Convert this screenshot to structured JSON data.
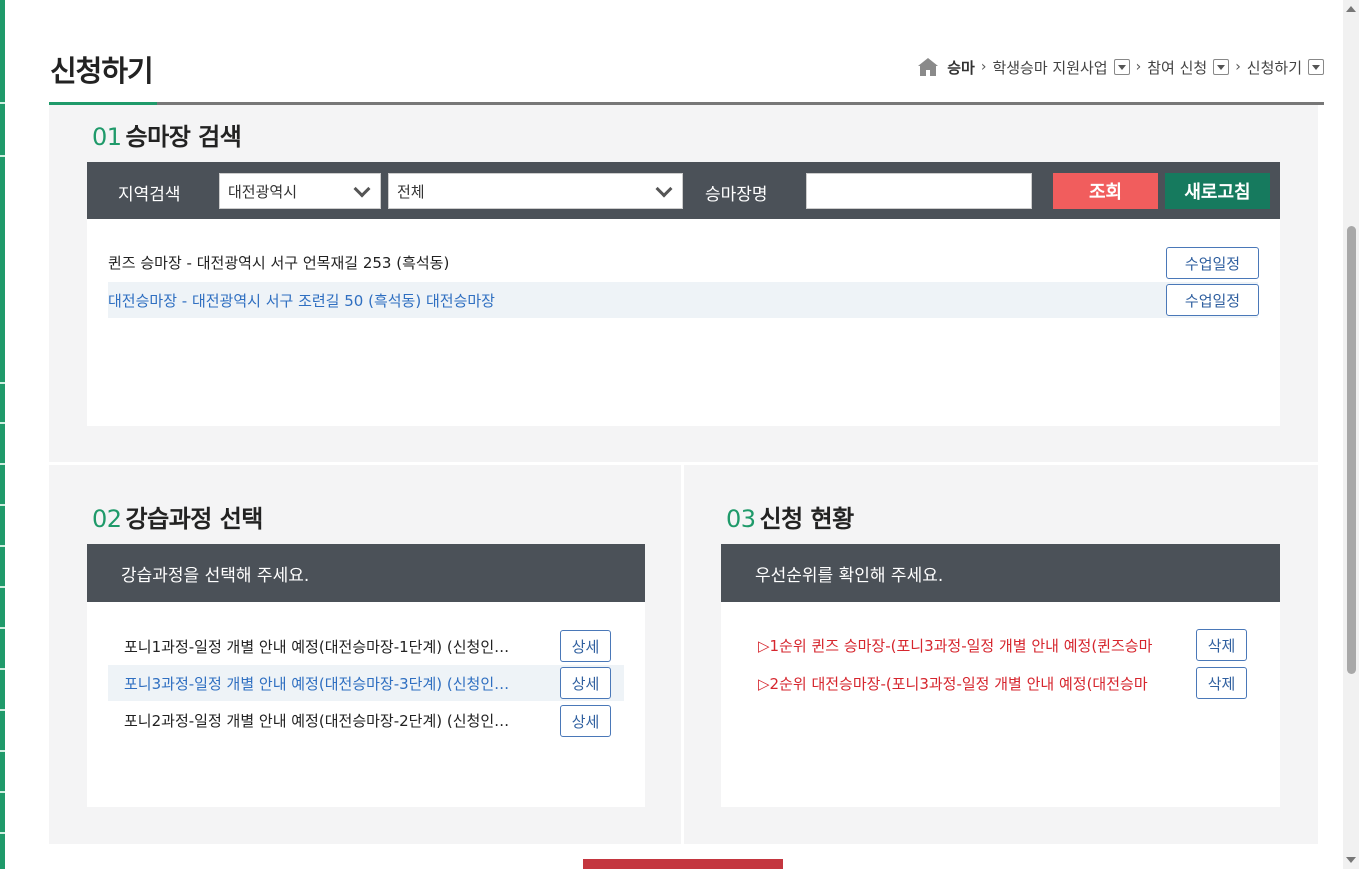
{
  "page_title": "신청하기",
  "breadcrumb": {
    "home": "승마",
    "items": [
      "학생승마 지원사업",
      "참여 신청",
      "신청하기"
    ]
  },
  "section1": {
    "num": "01",
    "title": "승마장 검색",
    "region_label": "지역검색",
    "region_select": "대전광역시",
    "district_select": "전체",
    "name_label": "승마장명",
    "name_value": "",
    "search_button": "조회",
    "refresh_button": "새로고침",
    "results": [
      {
        "text": "퀸즈 승마장 - 대전광역시 서구 언목재길 253 (흑석동)",
        "button": "수업일정",
        "selected": false
      },
      {
        "text": "대전승마장 - 대전광역시 서구 조련길 50 (흑석동) 대전승마장",
        "button": "수업일정",
        "selected": true
      }
    ]
  },
  "section2": {
    "num": "02",
    "title": "강습과정 선택",
    "header": "강습과정을 선택해 주세요.",
    "courses": [
      {
        "text": "포니1과정-일정 개별 안내 예정(대전승마장-1단계) (신청인…",
        "button": "상세",
        "selected": false
      },
      {
        "text": "포니3과정-일정 개별 안내 예정(대전승마장-3단계) (신청인…",
        "button": "상세",
        "selected": true
      },
      {
        "text": "포니2과정-일정 개별 안내 예정(대전승마장-2단계) (신청인…",
        "button": "상세",
        "selected": false
      }
    ]
  },
  "section3": {
    "num": "03",
    "title": "신청 현황",
    "header": "우선순위를 확인해 주세요.",
    "items": [
      {
        "text": "▷1순위 퀸즈 승마장-(포니3과정-일정 개별 안내 예정(퀸즈승마",
        "button": "삭제"
      },
      {
        "text": "▷2순위 대전승마장-(포니3과정-일정 개별 안내 예정(대전승마",
        "button": "삭제"
      }
    ]
  },
  "colors": {
    "accent_green": "#1f9a6a",
    "bar_dark": "#4b5158",
    "search_red": "#f15d5d",
    "refresh_green": "#167a5e",
    "link_blue": "#2f6fc1",
    "status_red": "#d6262e"
  }
}
